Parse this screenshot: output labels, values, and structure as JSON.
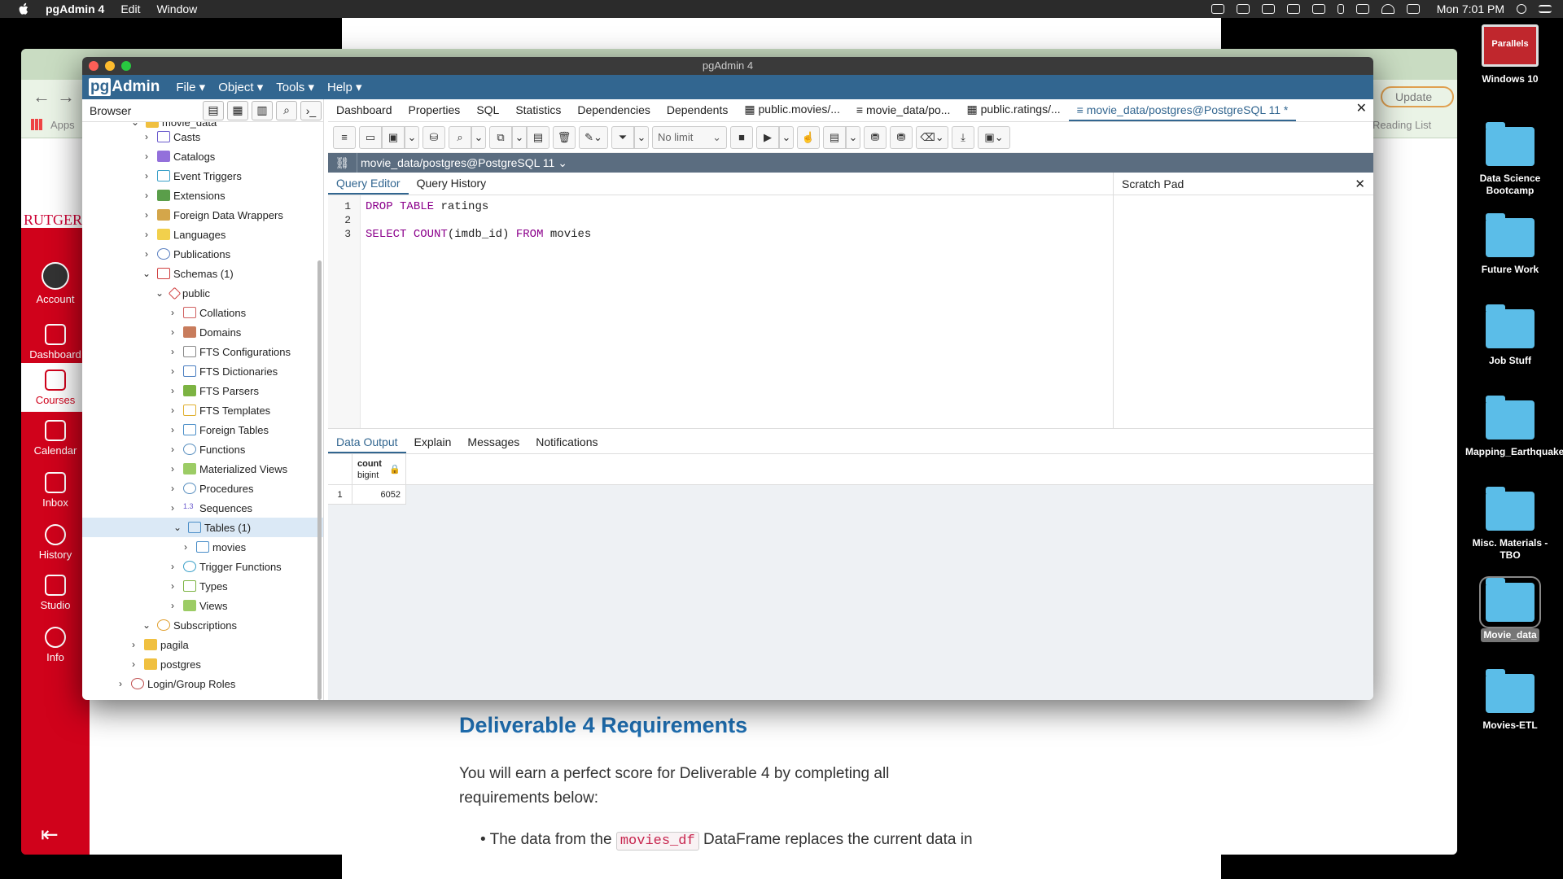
{
  "menubar": {
    "app_name": "pgAdmin 4",
    "items": [
      "Edit",
      "Window"
    ],
    "clock": "Mon 7:01 PM"
  },
  "browser_window": {
    "bookmark_apps": "Apps",
    "update_label": "Update",
    "reading_list": "Reading List",
    "canvas_logo": "RUTGERS",
    "canvas_nav": [
      "Account",
      "Dashboard",
      "Courses",
      "Calendar",
      "Inbox",
      "History",
      "Studio",
      "Info"
    ],
    "canvas_active": "Courses"
  },
  "page": {
    "heading": "Deliverable 4 Requirements",
    "paragraph": "You will earn a perfect score for Deliverable 4 by completing all requirements below:",
    "bullet_pre": "The data from the",
    "bullet_code": "movies_df",
    "bullet_post": "DataFrame replaces the current data in"
  },
  "desktop": {
    "parallels_label": "Parallels",
    "icons": [
      {
        "label": "Windows 10"
      },
      {
        "label": "Data Science Bootcamp"
      },
      {
        "label": "Future Work"
      },
      {
        "label": "Job Stuff"
      },
      {
        "label": "Mapping_Earthquakes"
      },
      {
        "label": "Misc. Materials - TBO"
      },
      {
        "label": "Movie_data"
      },
      {
        "label": "Movies-ETL"
      }
    ]
  },
  "pgadmin": {
    "window_title": "pgAdmin 4",
    "logo_pg": "pg",
    "logo_admin": "Admin",
    "menu": [
      "File",
      "Object",
      "Tools",
      "Help"
    ],
    "browser_title": "Browser",
    "tree": [
      {
        "label": "movie_data",
        "level": 2
      },
      {
        "label": "Casts",
        "level": 2
      },
      {
        "label": "Catalogs",
        "level": 2
      },
      {
        "label": "Event Triggers",
        "level": 2
      },
      {
        "label": "Extensions",
        "level": 2
      },
      {
        "label": "Foreign Data Wrappers",
        "level": 2
      },
      {
        "label": "Languages",
        "level": 2
      },
      {
        "label": "Publications",
        "level": 2
      },
      {
        "label": "Schemas (1)",
        "level": 2
      },
      {
        "label": "public",
        "level": 3
      },
      {
        "label": "Collations",
        "level": 4
      },
      {
        "label": "Domains",
        "level": 4
      },
      {
        "label": "FTS Configurations",
        "level": 4
      },
      {
        "label": "FTS Dictionaries",
        "level": 4
      },
      {
        "label": "FTS Parsers",
        "level": 4
      },
      {
        "label": "FTS Templates",
        "level": 4
      },
      {
        "label": "Foreign Tables",
        "level": 4
      },
      {
        "label": "Functions",
        "level": 4
      },
      {
        "label": "Materialized Views",
        "level": 4
      },
      {
        "label": "Procedures",
        "level": 4
      },
      {
        "label": "Sequences",
        "level": 4
      },
      {
        "label": "Tables (1)",
        "level": 4
      },
      {
        "label": "movies",
        "level": 5
      },
      {
        "label": "Trigger Functions",
        "level": 4
      },
      {
        "label": "Types",
        "level": 4
      },
      {
        "label": "Views",
        "level": 4
      },
      {
        "label": "Subscriptions",
        "level": 2
      },
      {
        "label": "pagila",
        "level": 1
      },
      {
        "label": "postgres",
        "level": 1
      },
      {
        "label": "Login/Group Roles",
        "level": 0
      }
    ],
    "tabs": [
      "Dashboard",
      "Properties",
      "SQL",
      "Statistics",
      "Dependencies",
      "Dependents",
      "public.movies/...",
      "movie_data/po...",
      "public.ratings/...",
      "movie_data/postgres@PostgreSQL 11 *"
    ],
    "active_tab": "movie_data/postgres@PostgreSQL 11 *",
    "toolbar": {
      "limit": "No limit"
    },
    "connection": "movie_data/postgres@PostgreSQL 11",
    "query_tabs": [
      "Query Editor",
      "Query History"
    ],
    "scratch_pad": "Scratch Pad",
    "sql_lines": [
      {
        "n": "1",
        "kw1": "DROP",
        "kw2": "TABLE",
        "rest": "ratings"
      },
      {
        "n": "2"
      },
      {
        "n": "3",
        "kw1": "SELECT",
        "fn": "COUNT",
        "arg": "(imdb_id)",
        "kw2": "FROM",
        "rest": "movies"
      }
    ],
    "output_tabs": [
      "Data Output",
      "Explain",
      "Messages",
      "Notifications"
    ],
    "result": {
      "column": "count",
      "type": "bigint",
      "row_num": "1",
      "value": "6052"
    }
  }
}
